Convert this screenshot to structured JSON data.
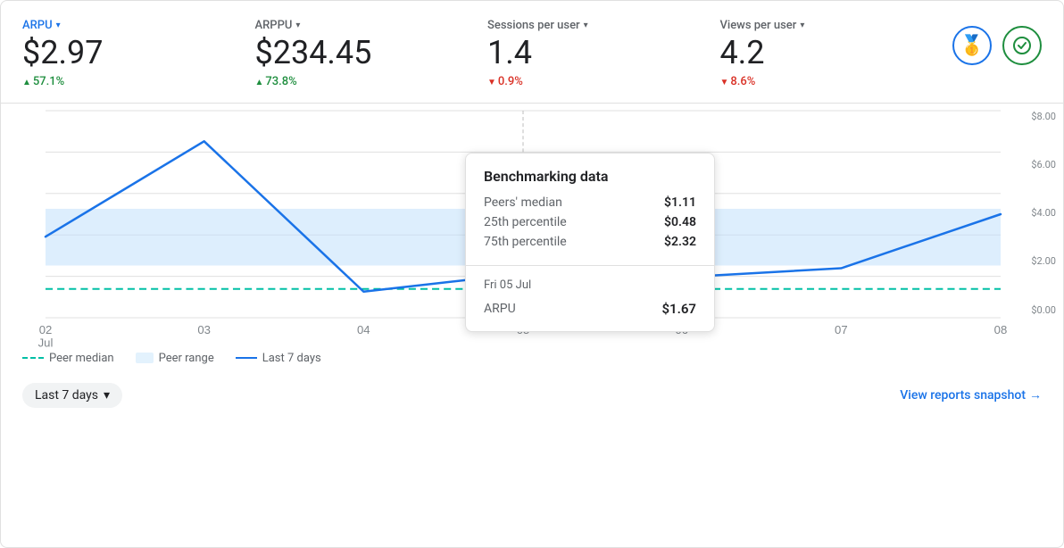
{
  "metrics": [
    {
      "id": "arpu",
      "label": "ARPU",
      "active": true,
      "value": "$2.97",
      "change": "57.1%",
      "direction": "positive"
    },
    {
      "id": "arppu",
      "label": "ARPPU",
      "active": false,
      "value": "$234.45",
      "change": "73.8%",
      "direction": "positive"
    },
    {
      "id": "sessions_per_user",
      "label": "Sessions per user",
      "active": false,
      "value": "1.4",
      "change": "0.9%",
      "direction": "negative"
    },
    {
      "id": "views_per_user",
      "label": "Views per user",
      "active": false,
      "value": "4.2",
      "change": "8.6%",
      "direction": "negative"
    }
  ],
  "legend": {
    "peer_median": "Peer median",
    "peer_range": "Peer range",
    "last_7_days": "Last 7 days"
  },
  "chart": {
    "x_labels": [
      "02",
      "03",
      "04",
      "05",
      "06",
      "07",
      "08"
    ],
    "x_sublabel": "Jul",
    "y_labels": [
      "$8.00",
      "$6.00",
      "$4.00",
      "$2.00",
      "$0.00"
    ]
  },
  "tooltip": {
    "title": "Benchmarking data",
    "peers_median_label": "Peers' median",
    "peers_median_value": "$1.11",
    "p25_label": "25th percentile",
    "p25_value": "$0.48",
    "p75_label": "75th percentile",
    "p75_value": "$2.32",
    "date": "Fri 05 Jul",
    "metric_label": "ARPU",
    "metric_value": "$1.67"
  },
  "footer": {
    "date_range": "Last 7 days",
    "chevron": "▾",
    "view_reports": "View reports snapshot",
    "arrow": "→"
  },
  "icons": {
    "medal": "🥇",
    "check": "✓"
  }
}
